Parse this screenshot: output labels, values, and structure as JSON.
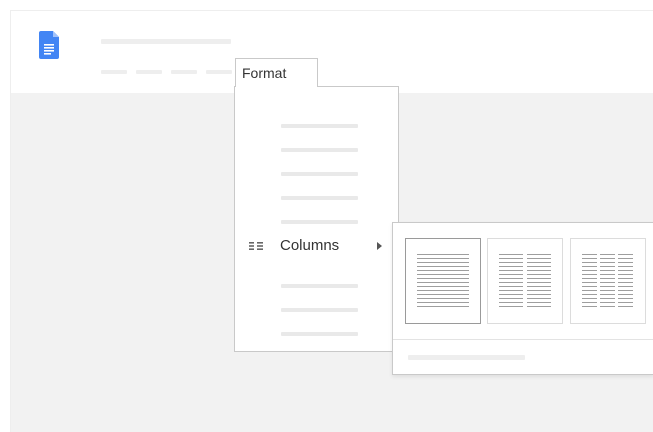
{
  "app": {
    "icon": "google-docs-icon",
    "accent_color": "#4285f4"
  },
  "menu": {
    "open_menu_label": "Format",
    "highlighted_item": {
      "label": "Columns",
      "icon": "columns-icon",
      "has_submenu": true
    }
  },
  "columns_submenu": {
    "presets": [
      {
        "name": "one-column",
        "columns": 1,
        "selected": true
      },
      {
        "name": "two-columns",
        "columns": 2,
        "selected": false
      },
      {
        "name": "three-columns",
        "columns": 3,
        "selected": false
      }
    ]
  }
}
